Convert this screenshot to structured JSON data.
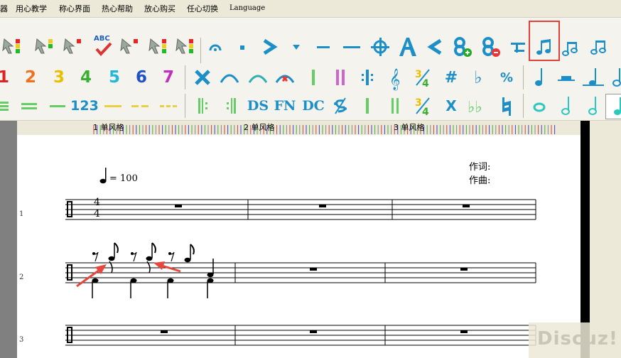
{
  "menu": {
    "items": [
      "器",
      "用心教学",
      "称心界面",
      "热心帮助",
      "放心购买",
      "任心切换",
      "Language"
    ]
  },
  "toolbar2": {
    "numbers": [
      "1",
      "2",
      "3",
      "4",
      "5",
      "6",
      "7"
    ],
    "symbol_percent": "%",
    "sharp": "#",
    "flat": "♭"
  },
  "toolbar1": {
    "abc_label": "ABC"
  },
  "toolbar3": {
    "label_123": "123",
    "ds_label": "DS",
    "fn_label": "FN",
    "dc_label": "DC",
    "x_label": "X"
  },
  "ruler": {
    "labels": [
      "1  单风格",
      "2  单风格",
      "3  单风格"
    ]
  },
  "score": {
    "tempo_value": "= 100",
    "lyricist_label": "作词:",
    "composer_label": "作曲:",
    "time_sig_top": "4",
    "time_sig_bottom": "4",
    "row_numbers": [
      "1",
      "2",
      "3"
    ]
  },
  "watermark": "Discuz!",
  "colors": {
    "icon_blue": "#1c8fc8",
    "highlight": "#e0403a",
    "annotation_arrow": "#e8473e"
  }
}
